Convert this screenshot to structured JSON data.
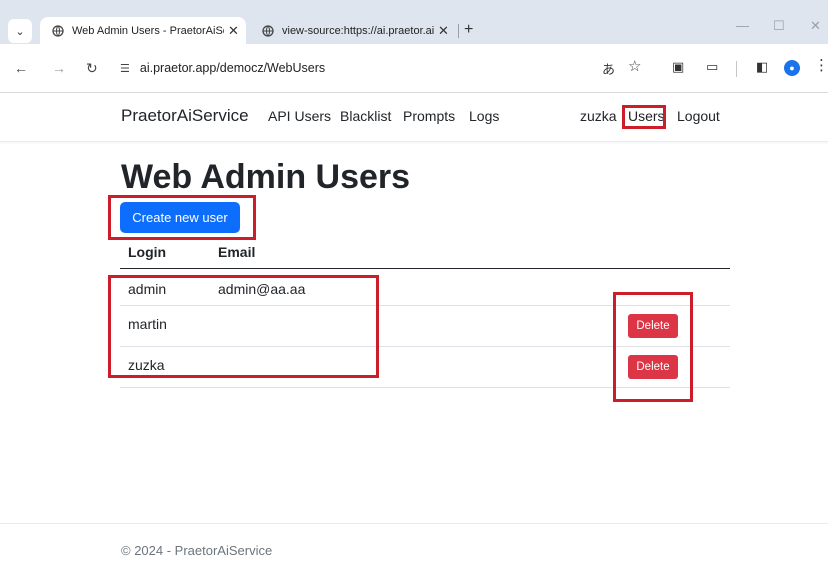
{
  "browser": {
    "tabs": [
      {
        "title": "Web Admin Users - PraetorAiSe",
        "active": true
      },
      {
        "title": "view-source:https://ai.praetor.ai",
        "active": false
      }
    ],
    "address": "ai.praetor.app/democz/WebUsers",
    "icons": {
      "tab_search": "chevron-down-icon",
      "favicon": "globe-icon",
      "close": "close-icon",
      "new_tab": "plus-icon",
      "back": "back-arrow-icon",
      "forward": "forward-arrow-icon",
      "reload": "reload-icon",
      "site_info": "tune-icon",
      "translate": "translate-icon",
      "bookmark": "star-icon",
      "extension": "selenium-extension-icon",
      "extensions": "puzzle-icon",
      "side_panel": "side-panel-icon",
      "profile": "profile-icon",
      "menu": "kebab-menu-icon"
    }
  },
  "navbar": {
    "brand": "PraetorAiService",
    "links": [
      "API Users",
      "Blacklist",
      "Prompts",
      "Logs"
    ],
    "user": "zuzka",
    "users_link": "Users",
    "logout": "Logout"
  },
  "page": {
    "title": "Web Admin Users",
    "create_button": "Create new user",
    "table": {
      "headers": [
        "Login",
        "Email"
      ],
      "rows": [
        {
          "login": "admin",
          "email": "admin@aa.aa",
          "action": ""
        },
        {
          "login": "martin",
          "email": "",
          "action": "Delete"
        },
        {
          "login": "zuzka",
          "email": "",
          "action": "Delete"
        }
      ]
    }
  },
  "footer": {
    "text": "© 2024 - PraetorAiService"
  },
  "colors": {
    "highlight": "#cc1e2a",
    "primary": "#0d6efd",
    "danger": "#dc3545"
  }
}
